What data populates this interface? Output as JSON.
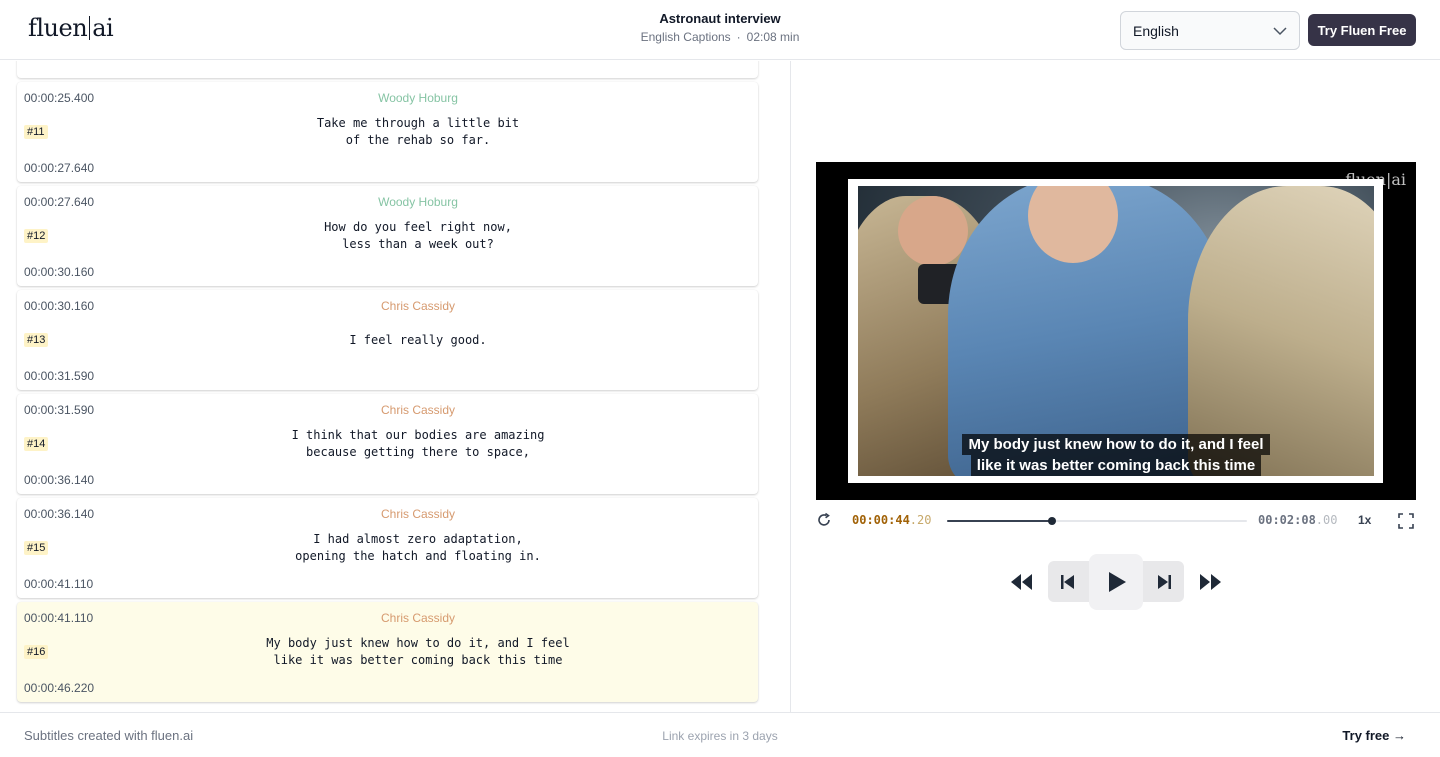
{
  "header": {
    "logo_left": "fluen",
    "logo_right": "ai",
    "title": "Astronaut interview",
    "captions_label": "English Captions",
    "separator": "·",
    "duration": "02:08 min",
    "language_value": "English",
    "try_button": "Try Fluen Free"
  },
  "subtitles": [
    {
      "start": "00:00:25.400",
      "end": "00:00:27.640",
      "number": "#11",
      "speaker": "Woody Hoburg",
      "speaker_key": "woody",
      "lines": [
        "Take me through a little bit",
        "of the rehab so far."
      ],
      "active": false
    },
    {
      "start": "00:00:27.640",
      "end": "00:00:30.160",
      "number": "#12",
      "speaker": "Woody Hoburg",
      "speaker_key": "woody",
      "lines": [
        "How do you feel right now,",
        "less than a week out?"
      ],
      "active": false
    },
    {
      "start": "00:00:30.160",
      "end": "00:00:31.590",
      "number": "#13",
      "speaker": "Chris Cassidy",
      "speaker_key": "chris",
      "lines": [
        "I feel really good."
      ],
      "active": false
    },
    {
      "start": "00:00:31.590",
      "end": "00:00:36.140",
      "number": "#14",
      "speaker": "Chris Cassidy",
      "speaker_key": "chris",
      "lines": [
        "I think that our bodies are amazing",
        "because getting there to space,"
      ],
      "active": false
    },
    {
      "start": "00:00:36.140",
      "end": "00:00:41.110",
      "number": "#15",
      "speaker": "Chris Cassidy",
      "speaker_key": "chris",
      "lines": [
        "I had almost zero adaptation,",
        "opening the hatch and floating in."
      ],
      "active": false
    },
    {
      "start": "00:00:41.110",
      "end": "00:00:46.220",
      "number": "#16",
      "speaker": "Chris Cassidy",
      "speaker_key": "chris",
      "lines": [
        "My body just knew how to do it, and I feel",
        "like it was better coming back this time"
      ],
      "active": true
    }
  ],
  "player": {
    "watermark": "fluen|ai",
    "caption_lines": [
      "My body just knew how to do it, and I feel",
      "like it was better coming back this time"
    ],
    "current_time_main": "00:00:44",
    "current_time_frac": ".20",
    "duration_main": "00:02:08",
    "duration_frac": ".00",
    "progress": 0.35,
    "speed": "1x"
  },
  "footer": {
    "credit": "Subtitles created with fluen.ai",
    "expiry": "Link expires in 3 days",
    "try_link": "Try free →"
  },
  "colors": {
    "accent_button": "#363347",
    "woody": "#86c4a4",
    "chris": "#d69a6f",
    "active_row": "#fefce8",
    "time_accent": "#a16207"
  }
}
